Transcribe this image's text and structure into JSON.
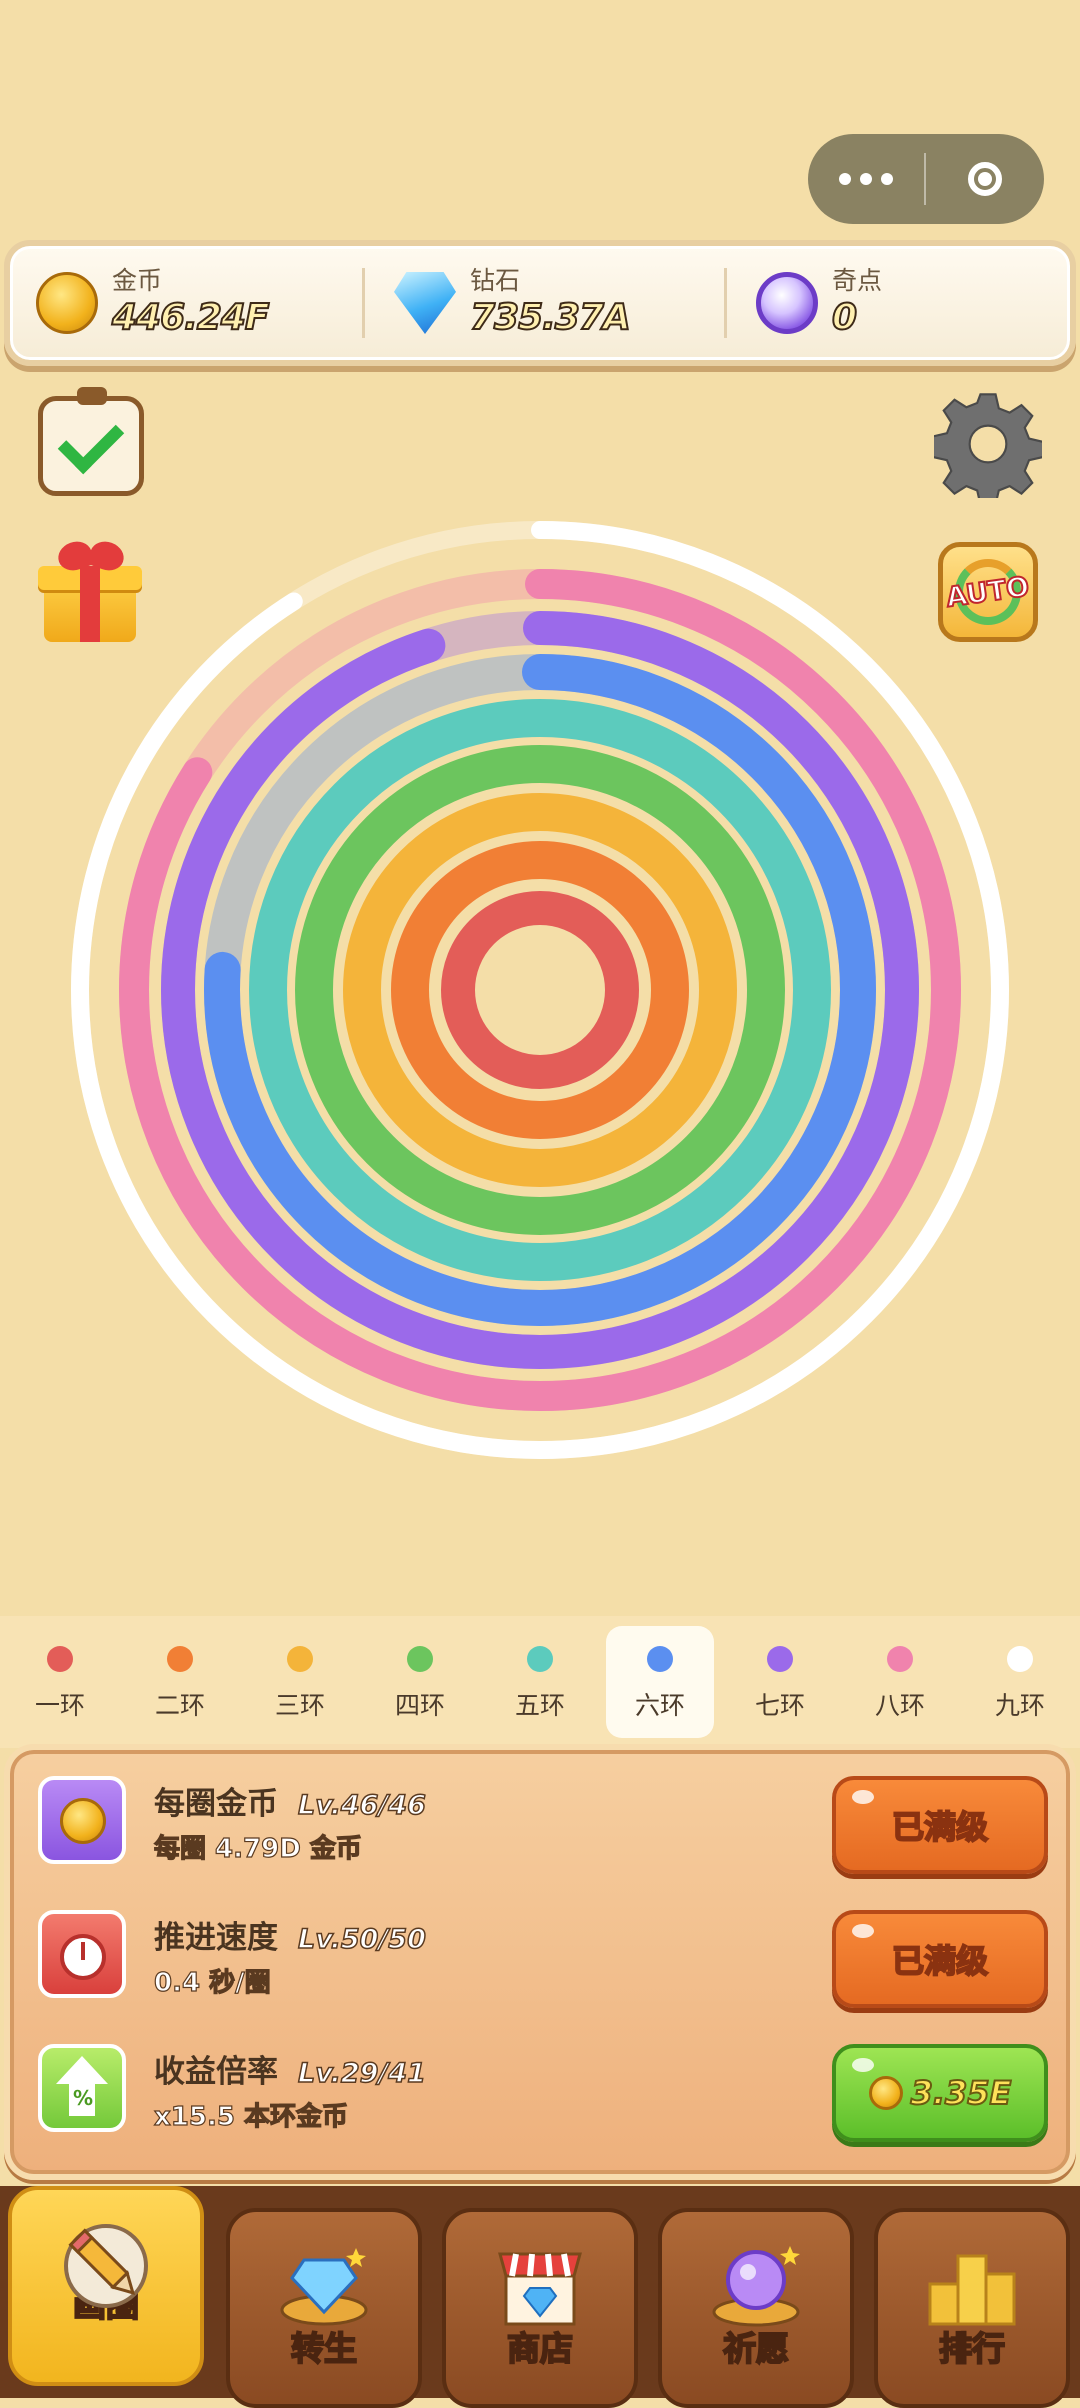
{
  "currencies": {
    "gold": {
      "label": "金币",
      "value": "446.24F",
      "icon": "coin-icon"
    },
    "diamond": {
      "label": "钻石",
      "value": "735.37A",
      "icon": "diamond-icon"
    },
    "oddity": {
      "label": "奇点",
      "value": "0",
      "icon": "orb-icon"
    }
  },
  "rings": {
    "colors": [
      "#e35d58",
      "#f17f35",
      "#f4b43a",
      "#6cc55e",
      "#5ccbbd",
      "#5b8ff0",
      "#9b6aea",
      "#f083ad",
      "#ffffff"
    ],
    "progress": [
      1,
      1,
      1,
      1,
      1,
      0.76,
      0.95,
      0.84,
      0.91
    ]
  },
  "tabs": [
    {
      "label": "一环",
      "color": "#e35d58"
    },
    {
      "label": "二环",
      "color": "#f17f35"
    },
    {
      "label": "三环",
      "color": "#f4b43a"
    },
    {
      "label": "四环",
      "color": "#6cc55e"
    },
    {
      "label": "五环",
      "color": "#5ccbbd"
    },
    {
      "label": "六环",
      "color": "#5b8ff0"
    },
    {
      "label": "七环",
      "color": "#9b6aea"
    },
    {
      "label": "八环",
      "color": "#f083ad"
    },
    {
      "label": "九环",
      "color": "#ffffff"
    }
  ],
  "active_tab": "六环",
  "upgrades": [
    {
      "name": "每圈金币",
      "level": "Lv.46/46",
      "desc": "每圈 4.79D 金币",
      "button": "已满级",
      "icon": "coin-upgrade-icon"
    },
    {
      "name": "推进速度",
      "level": "Lv.50/50",
      "desc": "0.4 秒/圈",
      "button": "已满级",
      "icon": "stopwatch-icon"
    },
    {
      "name": "收益倍率",
      "level": "Lv.29/41",
      "desc": "x15.5 本环金币",
      "button": "3.35E",
      "icon": "percent-arrow-icon"
    }
  ],
  "nav": [
    {
      "label": "画圈",
      "icon": "pencil-icon"
    },
    {
      "label": "转生",
      "icon": "rebirth-crystal-icon"
    },
    {
      "label": "商店",
      "icon": "shop-icon"
    },
    {
      "label": "祈愿",
      "icon": "wish-orb-icon"
    },
    {
      "label": "排行",
      "icon": "podium-icon"
    }
  ]
}
